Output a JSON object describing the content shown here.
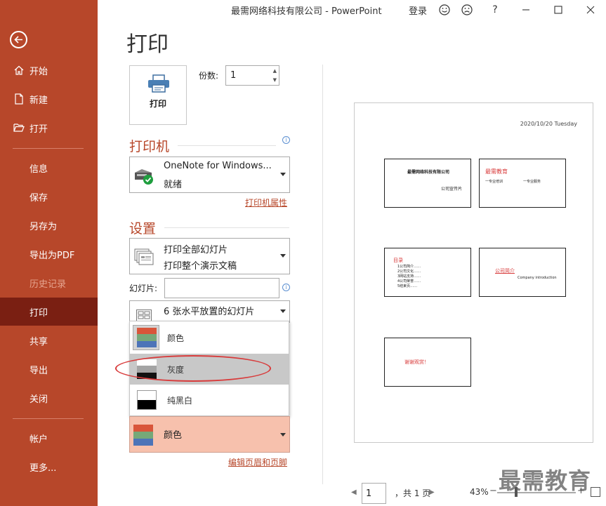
{
  "titlebar": {
    "title": "最需网络科技有限公司 - PowerPoint",
    "signin": "登录",
    "help": "?"
  },
  "sidebar": {
    "items": [
      {
        "label": "开始"
      },
      {
        "label": "新建"
      },
      {
        "label": "打开"
      },
      {
        "label": "信息"
      },
      {
        "label": "保存"
      },
      {
        "label": "另存为"
      },
      {
        "label": "导出为PDF"
      },
      {
        "label": "历史记录"
      },
      {
        "label": "打印"
      },
      {
        "label": "共享"
      },
      {
        "label": "导出"
      },
      {
        "label": "关闭"
      },
      {
        "label": "帐户"
      },
      {
        "label": "更多..."
      }
    ]
  },
  "main": {
    "heading": "打印",
    "print_button": "打印",
    "copies_label": "份数:",
    "copies_value": "1",
    "printer_section": "打印机",
    "printer_name": "OneNote for Windows...",
    "printer_status": "就绪",
    "printer_props_link": "打印机属性",
    "settings_section": "设置",
    "range_line1": "打印全部幻灯片",
    "range_line2": "打印整个演示文稿",
    "slides_label": "幻灯片:",
    "slides_value": "",
    "layout_value": "6 张水平放置的幻灯片",
    "color_options": [
      {
        "label": "颜色"
      },
      {
        "label": "灰度"
      },
      {
        "label": "纯黑白"
      }
    ],
    "color_selected": "颜色",
    "header_footer_link": "编辑页眉和页脚"
  },
  "preview": {
    "date": "2020/10/20 Tuesday",
    "slides": [
      {
        "line1": "最需网络科技有限公司",
        "line2": "公司宣传片"
      },
      {
        "line1": "最需教育",
        "line2": "一专业培训",
        "line3": "一专业服务"
      },
      {
        "line1": "目录",
        "items": [
          "1公司简介……",
          "2公司文化……",
          "3网站支持……",
          "4公司荣誉……",
          "5结束页……"
        ]
      },
      {
        "line1": "公司简介",
        "line2": "Company introduction"
      },
      {
        "line1": "谢谢观赏！"
      }
    ],
    "page_current": "1",
    "page_total": "，共 1 页",
    "zoom": "43%",
    "watermark": "最需教育"
  },
  "colors": {
    "accent": "#b7472a",
    "selected_nav": "#7a1f12",
    "color_selected_bg": "#f7c1ad",
    "annotation": "#d83b3b"
  }
}
